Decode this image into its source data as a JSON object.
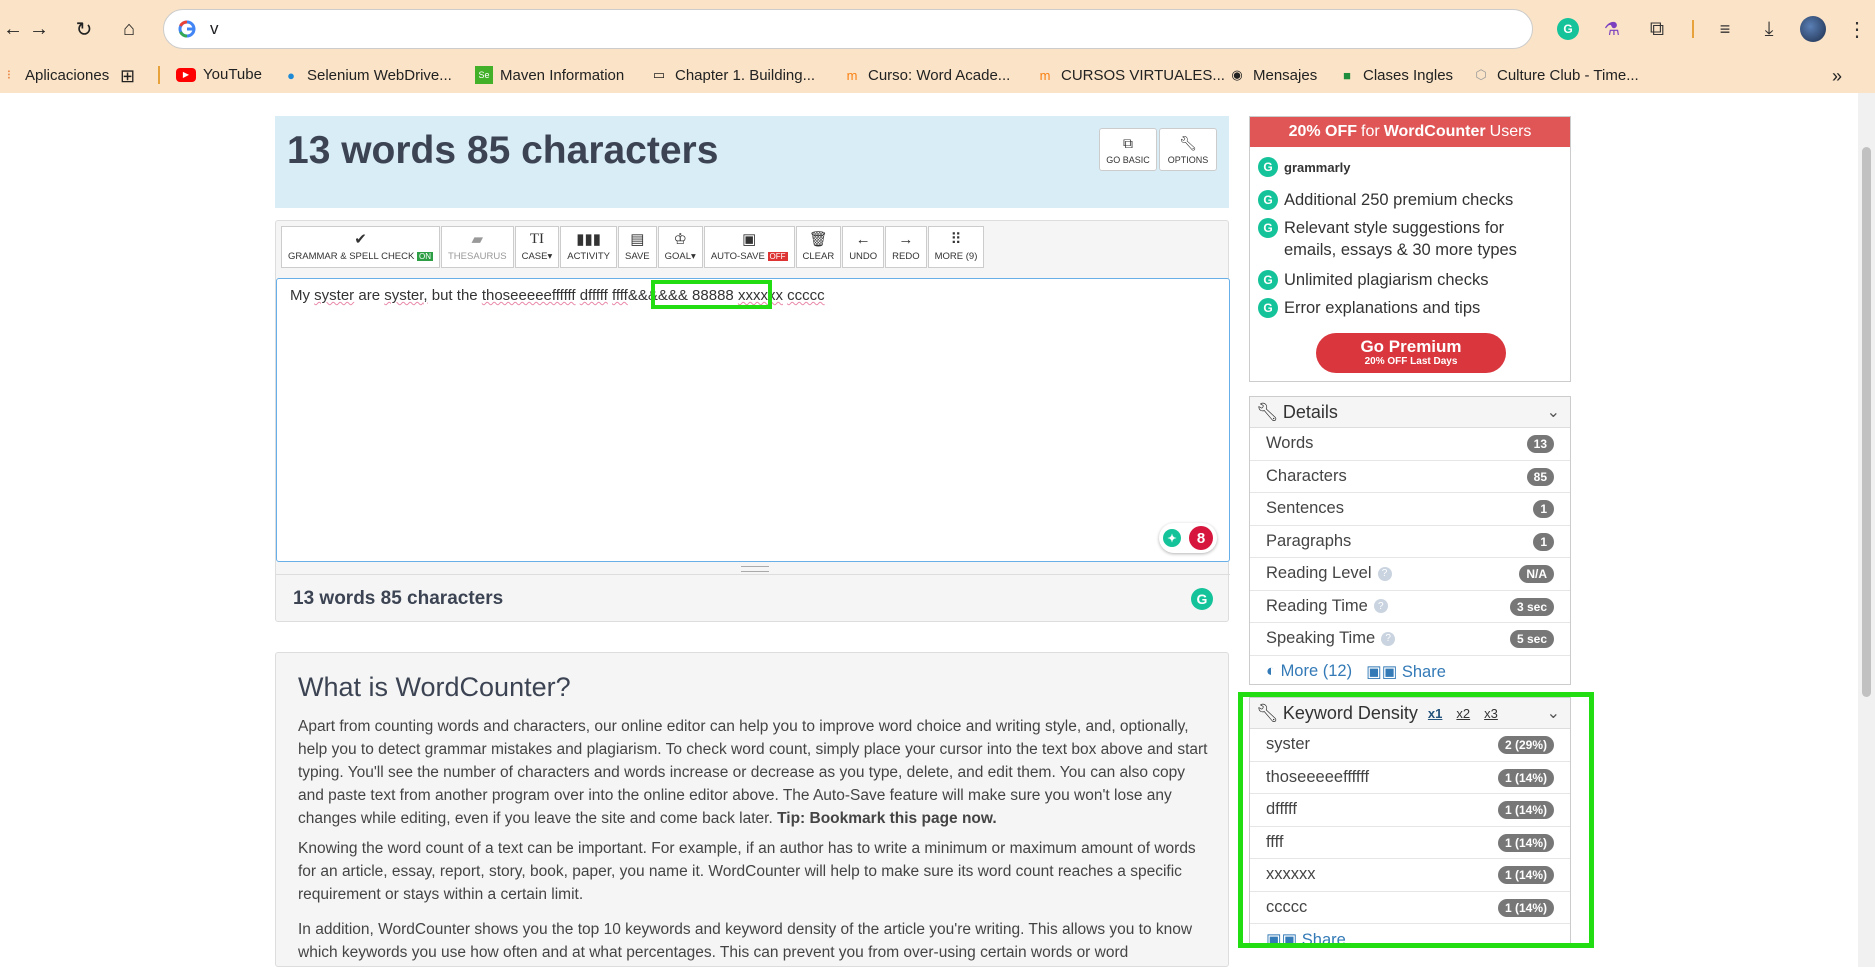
{
  "browser": {
    "url": "v",
    "bookmarks": [
      {
        "label": "Aplicaciones",
        "icon": "apps-icon"
      },
      {
        "label": "YouTube",
        "icon": "youtube-icon"
      },
      {
        "label": "Selenium WebDrive...",
        "icon": "selenium-icon"
      },
      {
        "label": "Maven Information",
        "icon": "maven-icon"
      },
      {
        "label": "Chapter 1. Building...",
        "icon": "book-icon"
      },
      {
        "label": "Curso: Word Acade...",
        "icon": "moodle-icon"
      },
      {
        "label": "CURSOS VIRTUALES...",
        "icon": "moodle-icon"
      },
      {
        "label": "Mensajes",
        "icon": "message-icon"
      },
      {
        "label": "Clases Ingles",
        "icon": "classroom-icon"
      },
      {
        "label": "Culture Club - Time...",
        "icon": "box-icon"
      }
    ]
  },
  "header": {
    "title": "13 words 85 characters",
    "go_basic": "GO BASIC",
    "options": "OPTIONS"
  },
  "toolbar": {
    "grammar": "GRAMMAR & SPELL CHECK",
    "grammar_state": "ON",
    "thesaurus": "THESAURUS",
    "case": "CASE",
    "activity": "ACTIVITY",
    "save": "SAVE",
    "goal": "GOAL",
    "autosave": "AUTO-SAVE",
    "autosave_state": "OFF",
    "clear": "CLEAR",
    "undo": "UNDO",
    "redo": "REDO",
    "more": "MORE (9)"
  },
  "editor": {
    "words": [
      "My",
      "syster",
      "are",
      "syster",
      ",",
      "but",
      "the",
      "thoseeeeeffffff",
      "dfffff",
      "ffff",
      "&&&&&&",
      "88888",
      "xxxxxx",
      "ccccc"
    ],
    "issues_count": "8"
  },
  "count_bar": {
    "text": "13 words 85 characters"
  },
  "article": {
    "title": "What is WordCounter?",
    "p1": "Apart from counting words and characters, our online editor can help you to improve word choice and writing style, and, optionally, help you to detect grammar mistakes and plagiarism. To check word count, simply place your cursor into the text box above and start typing. You'll see the number of characters and words increase or decrease as you type, delete, and edit them. You can also copy and paste text from another program over into the online editor above. The Auto-Save feature will make sure you won't lose any changes while editing, even if you leave the site and come back later.",
    "p1_tip": "Tip: Bookmark this page now.",
    "p2": "Knowing the word count of a text can be important. For example, if an author has to write a minimum or maximum amount of words for an article, essay, report, story, book, paper, you name it. WordCounter will help to make sure its word count reaches a specific requirement or stays within a certain limit.",
    "p3": "In addition, WordCounter shows you the top 10 keywords and keyword density of the article you're writing. This allows you to know which keywords you use how often and at what percentages. This can prevent you from over-using certain words or word"
  },
  "promo": {
    "bar_prefix": "20% OFF",
    "bar_mid": "for",
    "bar_brand": "WordCounter",
    "bar_suffix": "Users",
    "brand": "grammarly",
    "items": [
      "Additional 250 premium checks",
      "Relevant style suggestions for emails, essays & 30 more types",
      "Unlimited plagiarism checks",
      "Error explanations and tips"
    ],
    "cta": "Go Premium",
    "cta_sub": "20% OFF Last Days"
  },
  "details": {
    "title": "Details",
    "rows": [
      {
        "label": "Words",
        "value": "13"
      },
      {
        "label": "Characters",
        "value": "85"
      },
      {
        "label": "Sentences",
        "value": "1"
      },
      {
        "label": "Paragraphs",
        "value": "1"
      },
      {
        "label": "Reading Level",
        "value": "N/A"
      },
      {
        "label": "Reading Time",
        "value": "3 sec"
      },
      {
        "label": "Speaking Time",
        "value": "5 sec"
      }
    ],
    "more": "More (12)",
    "share": "Share"
  },
  "keyword_density": {
    "title": "Keyword Density",
    "tabs": [
      "x1",
      "x2",
      "x3"
    ],
    "rows": [
      {
        "label": "syster",
        "value": "2 (29%)"
      },
      {
        "label": "thoseeeeeffffff",
        "value": "1 (14%)"
      },
      {
        "label": "dfffff",
        "value": "1 (14%)"
      },
      {
        "label": "ffff",
        "value": "1 (14%)"
      },
      {
        "label": "xxxxxx",
        "value": "1 (14%)"
      },
      {
        "label": "ccccc",
        "value": "1 (14%)"
      }
    ],
    "share": "Share"
  },
  "colors": {
    "highlight": "#22dd11",
    "grammarly": "#15c39a",
    "promo": "#e05555"
  }
}
